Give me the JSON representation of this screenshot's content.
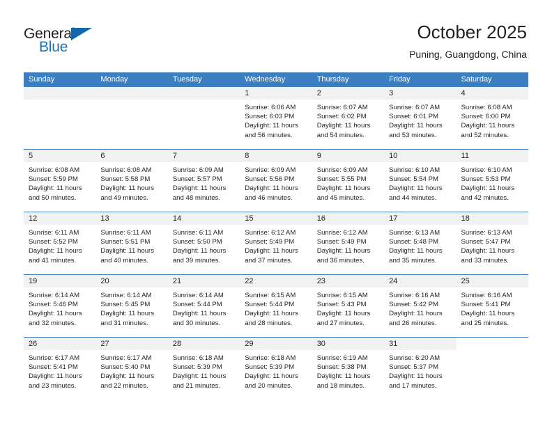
{
  "brand": {
    "name_part1": "General",
    "name_part2": "Blue",
    "triangle_icon": "triangle-icon",
    "accent_color": "#1267ae"
  },
  "header": {
    "title": "October 2025",
    "subtitle": "Puning, Guangdong, China"
  },
  "calendar": {
    "header_color": "#3c7fc1",
    "band_color": "#f1f1f1",
    "weekdays": [
      "Sunday",
      "Monday",
      "Tuesday",
      "Wednesday",
      "Thursday",
      "Friday",
      "Saturday"
    ],
    "weeks": [
      [
        {
          "day": "",
          "empty": true
        },
        {
          "day": "",
          "empty": true
        },
        {
          "day": "",
          "empty": true
        },
        {
          "day": "1",
          "sunrise": "Sunrise: 6:06 AM",
          "sunset": "Sunset: 6:03 PM",
          "daylight1": "Daylight: 11 hours",
          "daylight2": "and 56 minutes."
        },
        {
          "day": "2",
          "sunrise": "Sunrise: 6:07 AM",
          "sunset": "Sunset: 6:02 PM",
          "daylight1": "Daylight: 11 hours",
          "daylight2": "and 54 minutes."
        },
        {
          "day": "3",
          "sunrise": "Sunrise: 6:07 AM",
          "sunset": "Sunset: 6:01 PM",
          "daylight1": "Daylight: 11 hours",
          "daylight2": "and 53 minutes."
        },
        {
          "day": "4",
          "sunrise": "Sunrise: 6:08 AM",
          "sunset": "Sunset: 6:00 PM",
          "daylight1": "Daylight: 11 hours",
          "daylight2": "and 52 minutes."
        }
      ],
      [
        {
          "day": "5",
          "sunrise": "Sunrise: 6:08 AM",
          "sunset": "Sunset: 5:59 PM",
          "daylight1": "Daylight: 11 hours",
          "daylight2": "and 50 minutes."
        },
        {
          "day": "6",
          "sunrise": "Sunrise: 6:08 AM",
          "sunset": "Sunset: 5:58 PM",
          "daylight1": "Daylight: 11 hours",
          "daylight2": "and 49 minutes."
        },
        {
          "day": "7",
          "sunrise": "Sunrise: 6:09 AM",
          "sunset": "Sunset: 5:57 PM",
          "daylight1": "Daylight: 11 hours",
          "daylight2": "and 48 minutes."
        },
        {
          "day": "8",
          "sunrise": "Sunrise: 6:09 AM",
          "sunset": "Sunset: 5:56 PM",
          "daylight1": "Daylight: 11 hours",
          "daylight2": "and 46 minutes."
        },
        {
          "day": "9",
          "sunrise": "Sunrise: 6:09 AM",
          "sunset": "Sunset: 5:55 PM",
          "daylight1": "Daylight: 11 hours",
          "daylight2": "and 45 minutes."
        },
        {
          "day": "10",
          "sunrise": "Sunrise: 6:10 AM",
          "sunset": "Sunset: 5:54 PM",
          "daylight1": "Daylight: 11 hours",
          "daylight2": "and 44 minutes."
        },
        {
          "day": "11",
          "sunrise": "Sunrise: 6:10 AM",
          "sunset": "Sunset: 5:53 PM",
          "daylight1": "Daylight: 11 hours",
          "daylight2": "and 42 minutes."
        }
      ],
      [
        {
          "day": "12",
          "sunrise": "Sunrise: 6:11 AM",
          "sunset": "Sunset: 5:52 PM",
          "daylight1": "Daylight: 11 hours",
          "daylight2": "and 41 minutes."
        },
        {
          "day": "13",
          "sunrise": "Sunrise: 6:11 AM",
          "sunset": "Sunset: 5:51 PM",
          "daylight1": "Daylight: 11 hours",
          "daylight2": "and 40 minutes."
        },
        {
          "day": "14",
          "sunrise": "Sunrise: 6:11 AM",
          "sunset": "Sunset: 5:50 PM",
          "daylight1": "Daylight: 11 hours",
          "daylight2": "and 39 minutes."
        },
        {
          "day": "15",
          "sunrise": "Sunrise: 6:12 AM",
          "sunset": "Sunset: 5:49 PM",
          "daylight1": "Daylight: 11 hours",
          "daylight2": "and 37 minutes."
        },
        {
          "day": "16",
          "sunrise": "Sunrise: 6:12 AM",
          "sunset": "Sunset: 5:49 PM",
          "daylight1": "Daylight: 11 hours",
          "daylight2": "and 36 minutes."
        },
        {
          "day": "17",
          "sunrise": "Sunrise: 6:13 AM",
          "sunset": "Sunset: 5:48 PM",
          "daylight1": "Daylight: 11 hours",
          "daylight2": "and 35 minutes."
        },
        {
          "day": "18",
          "sunrise": "Sunrise: 6:13 AM",
          "sunset": "Sunset: 5:47 PM",
          "daylight1": "Daylight: 11 hours",
          "daylight2": "and 33 minutes."
        }
      ],
      [
        {
          "day": "19",
          "sunrise": "Sunrise: 6:14 AM",
          "sunset": "Sunset: 5:46 PM",
          "daylight1": "Daylight: 11 hours",
          "daylight2": "and 32 minutes."
        },
        {
          "day": "20",
          "sunrise": "Sunrise: 6:14 AM",
          "sunset": "Sunset: 5:45 PM",
          "daylight1": "Daylight: 11 hours",
          "daylight2": "and 31 minutes."
        },
        {
          "day": "21",
          "sunrise": "Sunrise: 6:14 AM",
          "sunset": "Sunset: 5:44 PM",
          "daylight1": "Daylight: 11 hours",
          "daylight2": "and 30 minutes."
        },
        {
          "day": "22",
          "sunrise": "Sunrise: 6:15 AM",
          "sunset": "Sunset: 5:44 PM",
          "daylight1": "Daylight: 11 hours",
          "daylight2": "and 28 minutes."
        },
        {
          "day": "23",
          "sunrise": "Sunrise: 6:15 AM",
          "sunset": "Sunset: 5:43 PM",
          "daylight1": "Daylight: 11 hours",
          "daylight2": "and 27 minutes."
        },
        {
          "day": "24",
          "sunrise": "Sunrise: 6:16 AM",
          "sunset": "Sunset: 5:42 PM",
          "daylight1": "Daylight: 11 hours",
          "daylight2": "and 26 minutes."
        },
        {
          "day": "25",
          "sunrise": "Sunrise: 6:16 AM",
          "sunset": "Sunset: 5:41 PM",
          "daylight1": "Daylight: 11 hours",
          "daylight2": "and 25 minutes."
        }
      ],
      [
        {
          "day": "26",
          "sunrise": "Sunrise: 6:17 AM",
          "sunset": "Sunset: 5:41 PM",
          "daylight1": "Daylight: 11 hours",
          "daylight2": "and 23 minutes."
        },
        {
          "day": "27",
          "sunrise": "Sunrise: 6:17 AM",
          "sunset": "Sunset: 5:40 PM",
          "daylight1": "Daylight: 11 hours",
          "daylight2": "and 22 minutes."
        },
        {
          "day": "28",
          "sunrise": "Sunrise: 6:18 AM",
          "sunset": "Sunset: 5:39 PM",
          "daylight1": "Daylight: 11 hours",
          "daylight2": "and 21 minutes."
        },
        {
          "day": "29",
          "sunrise": "Sunrise: 6:18 AM",
          "sunset": "Sunset: 5:39 PM",
          "daylight1": "Daylight: 11 hours",
          "daylight2": "and 20 minutes."
        },
        {
          "day": "30",
          "sunrise": "Sunrise: 6:19 AM",
          "sunset": "Sunset: 5:38 PM",
          "daylight1": "Daylight: 11 hours",
          "daylight2": "and 18 minutes."
        },
        {
          "day": "31",
          "sunrise": "Sunrise: 6:20 AM",
          "sunset": "Sunset: 5:37 PM",
          "daylight1": "Daylight: 11 hours",
          "daylight2": "and 17 minutes."
        },
        {
          "day": "",
          "empty": true,
          "no_band": true
        }
      ]
    ]
  }
}
